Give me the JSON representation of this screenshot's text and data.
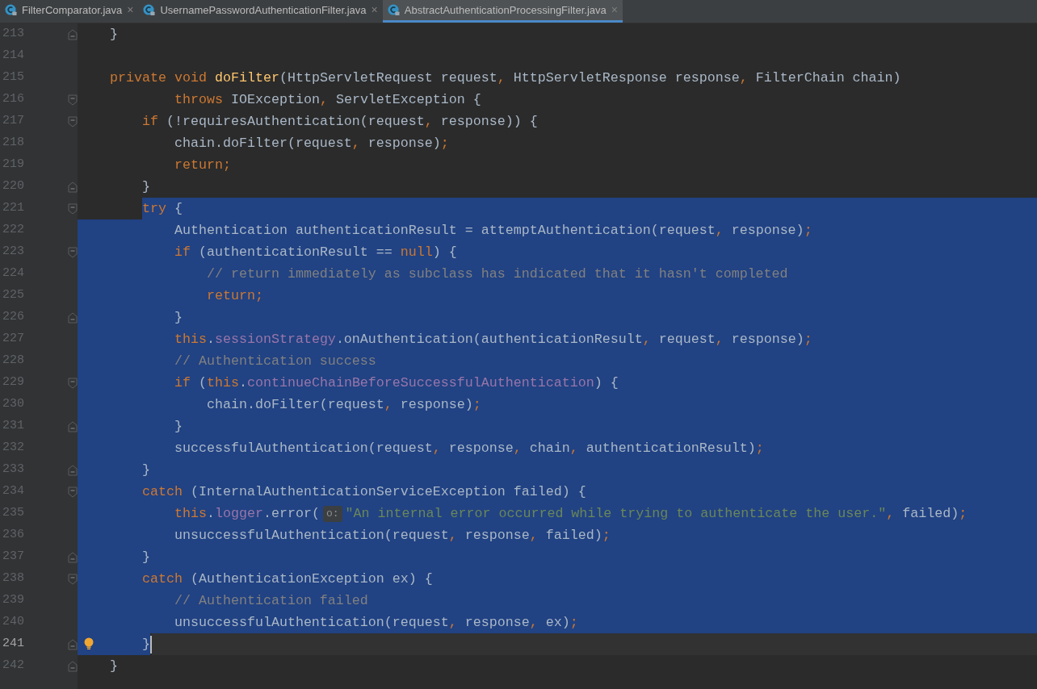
{
  "tabs": [
    {
      "label": "FilterComparator.java",
      "close": "×",
      "selected": false
    },
    {
      "label": "UsernamePasswordAuthenticationFilter.java",
      "close": "×",
      "selected": false
    },
    {
      "label": "AbstractAuthenticationProcessingFilter.java",
      "close": "×",
      "selected": true
    }
  ],
  "lines": [
    {
      "number": "213",
      "kind": "plain",
      "fold_start": false,
      "fold_end": true,
      "current": false,
      "tokens": [
        {
          "kind": "plain",
          "text": "    }"
        }
      ]
    },
    {
      "number": "214",
      "kind": "plain",
      "fold_start": false,
      "fold_end": false,
      "current": false
    },
    {
      "number": "215",
      "kind": "plain",
      "fold_start": false,
      "fold_end": false,
      "current": false,
      "tokens": [
        {
          "kind": "keyword",
          "text": "    private"
        },
        {
          "kind": "keyword",
          "text": " void"
        },
        {
          "kind": "method",
          "text": " doFilter"
        },
        {
          "kind": "plain",
          "text": "(HttpServletRequest request"
        },
        {
          "kind": "punct",
          "text": ","
        },
        {
          "kind": "plain",
          "text": " HttpServletResponse response"
        },
        {
          "kind": "punct",
          "text": ","
        },
        {
          "kind": "plain",
          "text": " FilterChain chain)"
        }
      ]
    },
    {
      "number": "216",
      "kind": "plain",
      "fold_start": true,
      "fold_end": false,
      "current": false,
      "tokens": [
        {
          "kind": "keyword",
          "text": "            throws"
        },
        {
          "kind": "plain",
          "text": " IOException"
        },
        {
          "kind": "punct",
          "text": ","
        },
        {
          "kind": "plain",
          "text": " ServletException {"
        }
      ]
    },
    {
      "number": "217",
      "kind": "plain",
      "fold_start": true,
      "fold_end": false,
      "current": false,
      "tokens": [
        {
          "kind": "keyword",
          "text": "        if"
        },
        {
          "kind": "plain",
          "text": " (!requiresAuthentication(request"
        },
        {
          "kind": "punct",
          "text": ","
        },
        {
          "kind": "plain",
          "text": " response)) {"
        }
      ]
    },
    {
      "number": "218",
      "kind": "plain",
      "fold_start": false,
      "fold_end": false,
      "current": false,
      "tokens": [
        {
          "kind": "plain",
          "text": "            chain.doFilter(request"
        },
        {
          "kind": "punct",
          "text": ","
        },
        {
          "kind": "plain",
          "text": " response)"
        },
        {
          "kind": "punct",
          "text": ";"
        }
      ]
    },
    {
      "number": "219",
      "kind": "plain",
      "fold_start": false,
      "fold_end": false,
      "current": false,
      "tokens": [
        {
          "kind": "keyword",
          "text": "            return"
        },
        {
          "kind": "punct",
          "text": ";"
        }
      ]
    },
    {
      "number": "220",
      "kind": "plain",
      "fold_start": false,
      "fold_end": true,
      "current": false,
      "tokens": [
        {
          "kind": "plain",
          "text": "        }"
        }
      ]
    },
    {
      "number": "221",
      "kind": "selection_start",
      "fold_start": true,
      "fold_end": false,
      "current": false,
      "tokens": [
        {
          "kind": "keyword",
          "text": "        try"
        },
        {
          "kind": "plain",
          "text": " {"
        }
      ]
    },
    {
      "number": "222",
      "kind": "selected",
      "fold_start": false,
      "fold_end": false,
      "current": false,
      "tokens": [
        {
          "kind": "plain",
          "text": "            Authentication authenticationResult = attemptAuthentication(request"
        },
        {
          "kind": "punct",
          "text": ","
        },
        {
          "kind": "plain",
          "text": " response)"
        },
        {
          "kind": "punct",
          "text": ";"
        }
      ]
    },
    {
      "number": "223",
      "kind": "selected",
      "fold_start": true,
      "fold_end": false,
      "current": false,
      "tokens": [
        {
          "kind": "keyword",
          "text": "            if"
        },
        {
          "kind": "plain",
          "text": " (authenticationResult =="
        },
        {
          "kind": "keyword",
          "text": " null"
        },
        {
          "kind": "plain",
          "text": ") {"
        }
      ]
    },
    {
      "number": "224",
      "kind": "selected",
      "fold_start": false,
      "fold_end": false,
      "current": false,
      "tokens": [
        {
          "kind": "comment",
          "text": "                // return immediately as subclass has indicated that it hasn't completed"
        }
      ]
    },
    {
      "number": "225",
      "kind": "selected",
      "fold_start": false,
      "fold_end": false,
      "current": false,
      "tokens": [
        {
          "kind": "keyword",
          "text": "                return"
        },
        {
          "kind": "punct",
          "text": ";"
        }
      ]
    },
    {
      "number": "226",
      "kind": "selected",
      "fold_start": false,
      "fold_end": true,
      "current": false,
      "tokens": [
        {
          "kind": "plain",
          "text": "            }"
        }
      ]
    },
    {
      "number": "227",
      "kind": "selected",
      "fold_start": false,
      "fold_end": false,
      "current": false,
      "tokens": [
        {
          "kind": "keyword",
          "text": "            this"
        },
        {
          "kind": "plain",
          "text": "."
        },
        {
          "kind": "field",
          "text": "sessionStrategy"
        },
        {
          "kind": "plain",
          "text": ".onAuthentication(authenticationResult"
        },
        {
          "kind": "punct",
          "text": ","
        },
        {
          "kind": "plain",
          "text": " request"
        },
        {
          "kind": "punct",
          "text": ","
        },
        {
          "kind": "plain",
          "text": " response)"
        },
        {
          "kind": "punct",
          "text": ";"
        }
      ]
    },
    {
      "number": "228",
      "kind": "selected",
      "fold_start": false,
      "fold_end": false,
      "current": false,
      "tokens": [
        {
          "kind": "comment",
          "text": "            // Authentication success"
        }
      ]
    },
    {
      "number": "229",
      "kind": "selected",
      "fold_start": true,
      "fold_end": false,
      "current": false,
      "tokens": [
        {
          "kind": "keyword",
          "text": "            if"
        },
        {
          "kind": "plain",
          "text": " ("
        },
        {
          "kind": "keyword",
          "text": "this"
        },
        {
          "kind": "plain",
          "text": "."
        },
        {
          "kind": "field",
          "text": "continueChainBeforeSuccessfulAuthentication"
        },
        {
          "kind": "plain",
          "text": ") {"
        }
      ]
    },
    {
      "number": "230",
      "kind": "selected",
      "fold_start": false,
      "fold_end": false,
      "current": false,
      "tokens": [
        {
          "kind": "plain",
          "text": "                chain.doFilter(request"
        },
        {
          "kind": "punct",
          "text": ","
        },
        {
          "kind": "plain",
          "text": " response)"
        },
        {
          "kind": "punct",
          "text": ";"
        }
      ]
    },
    {
      "number": "231",
      "kind": "selected",
      "fold_start": false,
      "fold_end": true,
      "current": false,
      "tokens": [
        {
          "kind": "plain",
          "text": "            }"
        }
      ]
    },
    {
      "number": "232",
      "kind": "selected",
      "fold_start": false,
      "fold_end": false,
      "current": false,
      "tokens": [
        {
          "kind": "plain",
          "text": "            successfulAuthentication(request"
        },
        {
          "kind": "punct",
          "text": ","
        },
        {
          "kind": "plain",
          "text": " response"
        },
        {
          "kind": "punct",
          "text": ","
        },
        {
          "kind": "plain",
          "text": " chain"
        },
        {
          "kind": "punct",
          "text": ","
        },
        {
          "kind": "plain",
          "text": " authenticationResult)"
        },
        {
          "kind": "punct",
          "text": ";"
        }
      ]
    },
    {
      "number": "233",
      "kind": "selected",
      "fold_start": false,
      "fold_end": true,
      "current": false,
      "tokens": [
        {
          "kind": "plain",
          "text": "        }"
        }
      ]
    },
    {
      "number": "234",
      "kind": "selected",
      "fold_start": true,
      "fold_end": false,
      "current": false,
      "tokens": [
        {
          "kind": "keyword",
          "text": "        catch"
        },
        {
          "kind": "plain",
          "text": " (InternalAuthenticationServiceException failed) {"
        }
      ]
    },
    {
      "number": "235",
      "kind": "selected",
      "fold_start": false,
      "fold_end": false,
      "current": false,
      "tokens": [
        {
          "kind": "keyword",
          "text": "            this"
        },
        {
          "kind": "plain",
          "text": "."
        },
        {
          "kind": "field",
          "text": "logger"
        },
        {
          "kind": "plain",
          "text": ".error("
        },
        {
          "kind": "hint",
          "text": "o:"
        },
        {
          "kind": "string",
          "text": "\"An internal error occurred while trying to authenticate the user.\""
        },
        {
          "kind": "punct",
          "text": ","
        },
        {
          "kind": "plain",
          "text": " failed)"
        },
        {
          "kind": "punct",
          "text": ";"
        }
      ]
    },
    {
      "number": "236",
      "kind": "selected",
      "fold_start": false,
      "fold_end": false,
      "current": false,
      "tokens": [
        {
          "kind": "plain",
          "text": "            unsuccessfulAuthentication(request"
        },
        {
          "kind": "punct",
          "text": ","
        },
        {
          "kind": "plain",
          "text": " response"
        },
        {
          "kind": "punct",
          "text": ","
        },
        {
          "kind": "plain",
          "text": " failed)"
        },
        {
          "kind": "punct",
          "text": ";"
        }
      ]
    },
    {
      "number": "237",
      "kind": "selected",
      "fold_start": false,
      "fold_end": true,
      "current": false,
      "tokens": [
        {
          "kind": "plain",
          "text": "        }"
        }
      ]
    },
    {
      "number": "238",
      "kind": "selected",
      "fold_start": true,
      "fold_end": false,
      "current": false,
      "tokens": [
        {
          "kind": "keyword",
          "text": "        catch"
        },
        {
          "kind": "plain",
          "text": " (AuthenticationException ex) {"
        }
      ]
    },
    {
      "number": "239",
      "kind": "selected",
      "fold_start": false,
      "fold_end": false,
      "current": false,
      "tokens": [
        {
          "kind": "comment",
          "text": "            // Authentication failed"
        }
      ]
    },
    {
      "number": "240",
      "kind": "selected",
      "fold_start": false,
      "fold_end": false,
      "current": false,
      "tokens": [
        {
          "kind": "plain",
          "text": "            unsuccessfulAuthentication(request"
        },
        {
          "kind": "punct",
          "text": ","
        },
        {
          "kind": "plain",
          "text": " response"
        },
        {
          "kind": "punct",
          "text": ","
        },
        {
          "kind": "plain",
          "text": " ex)"
        },
        {
          "kind": "punct",
          "text": ";"
        }
      ]
    },
    {
      "number": "241",
      "kind": "selection_end",
      "fold_start": false,
      "fold_end": true,
      "current": true,
      "tokens": [
        {
          "kind": "plain",
          "text": "        }"
        }
      ]
    },
    {
      "number": "242",
      "kind": "plain",
      "fold_start": false,
      "fold_end": true,
      "current": false,
      "tokens": [
        {
          "kind": "plain",
          "text": "    }"
        }
      ]
    }
  ]
}
